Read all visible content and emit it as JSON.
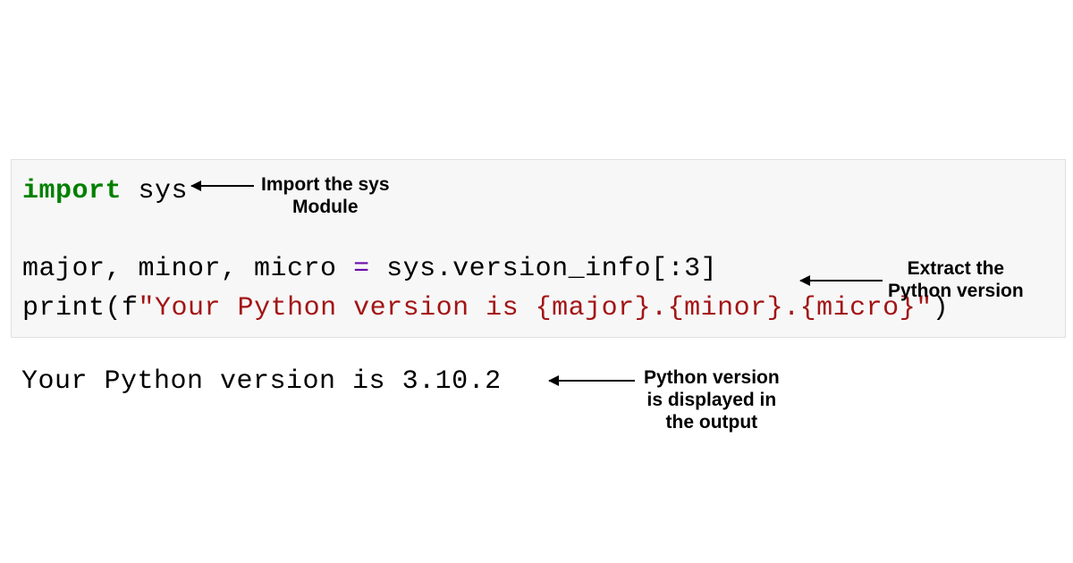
{
  "code": {
    "line1_kw": "import",
    "line1_rest": " sys",
    "line2_lhs": "major, minor, micro ",
    "line2_eq": "=",
    "line2_rhs": " sys.version_info[:3]",
    "line3_pre": "print(f",
    "line3_q1": "\"",
    "line3_str": "Your Python version is ",
    "line3_interp": "{major}.{minor}.{micro}",
    "line3_q2": "\"",
    "line3_post": ")"
  },
  "output": "Your Python version is 3.10.2",
  "annotations": {
    "a1_line1": "Import the sys",
    "a1_line2": "Module",
    "a2_line1": "Extract the",
    "a2_line2": "Python version",
    "a3_line1": "Python version",
    "a3_line2": "is displayed in",
    "a3_line3": "the output"
  }
}
